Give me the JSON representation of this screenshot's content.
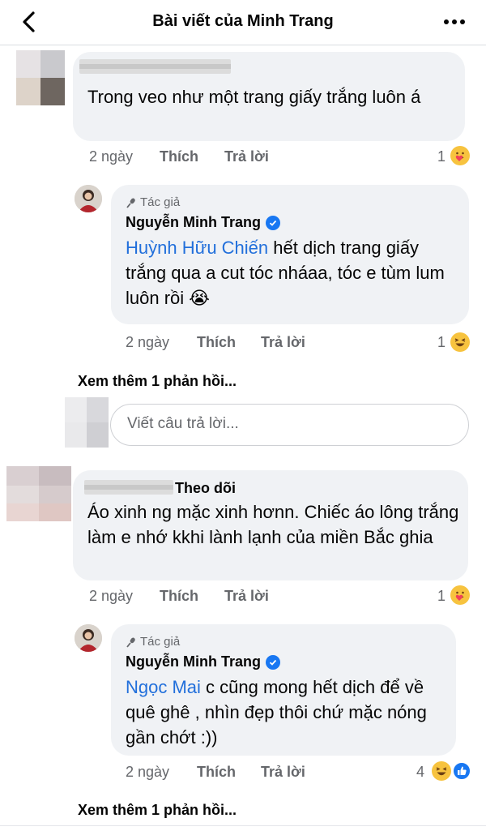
{
  "header": {
    "title": "Bài viết của Minh Trang",
    "back_icon": "chevron-left-icon",
    "more_icon": "more-horizontal-icon"
  },
  "comments": [
    {
      "text": "Trong veo như một trang giấy trắng luôn á",
      "time": "2 ngày",
      "like": "Thích",
      "reply": "Trả lời",
      "reaction_count": "1",
      "reactions": [
        "care-icon"
      ]
    },
    {
      "author_tag": "Tác giả",
      "author": "Nguyễn Minh Trang",
      "mention": "Huỳnh Hữu Chiến",
      "text": " hết dịch trang giấy trắng qua a cut tóc nháaa, tóc e tùm lum luôn rồi 😭",
      "time": "2 ngày",
      "like": "Thích",
      "reply": "Trả lời",
      "reaction_count": "1",
      "reactions": [
        "haha-icon"
      ]
    },
    {
      "follow": "Theo dõi",
      "text": "Áo xinh ng mặc xinh hơnn. Chiếc áo lông trắng làm e nhớ kkhi lành lạnh của miền Bắc ghia",
      "time": "2 ngày",
      "like": "Thích",
      "reply": "Trả lời",
      "reaction_count": "1",
      "reactions": [
        "care-icon"
      ]
    },
    {
      "author_tag": "Tác giả",
      "author": "Nguyễn Minh Trang",
      "mention": "Ngọc Mai",
      "text": " c cũng mong hết dịch để về quê ghê , nhìn đẹp thôi chứ mặc nóng gần chớt :))",
      "time": "2 ngày",
      "like": "Thích",
      "reply": "Trả lời",
      "reaction_count": "4",
      "reactions": [
        "haha-icon",
        "like-icon"
      ]
    }
  ],
  "see_more_1": "Xem thêm 1 phản hồi...",
  "see_more_2": "Xem thêm 1 phản hồi...",
  "reply_input": {
    "placeholder": "Viết câu trả lời..."
  },
  "colors": {
    "mention": "#216fdb",
    "bubble": "#f0f2f5",
    "verified": "#1877f2",
    "muted": "#65676b"
  }
}
